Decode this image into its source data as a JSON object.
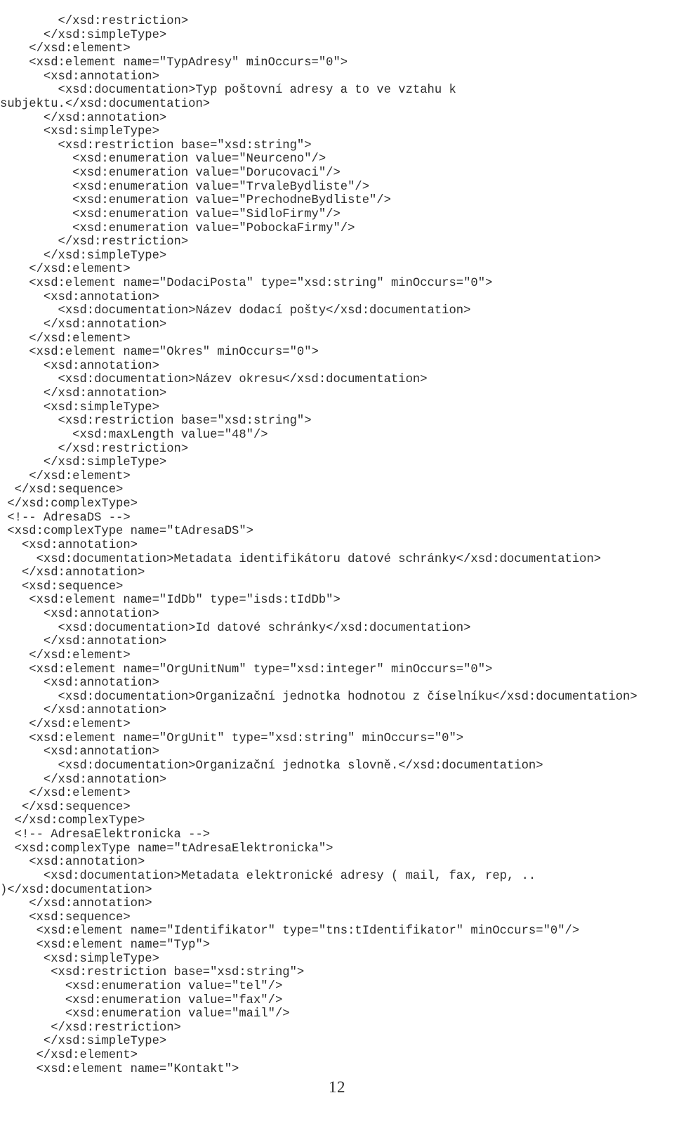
{
  "document": {
    "kind": "xsd-schema-listing",
    "page_number": "12",
    "language": "xml",
    "font_style": "monospace"
  },
  "code": {
    "lines": [
      "        </xsd:restriction>",
      "      </xsd:simpleType>",
      "    </xsd:element>",
      "    <xsd:element name=\"TypAdresy\" minOccurs=\"0\">",
      "      <xsd:annotation>",
      "        <xsd:documentation>Typ poštovní adresy a to ve vztahu k",
      "subjektu.</xsd:documentation>",
      "      </xsd:annotation>",
      "      <xsd:simpleType>",
      "        <xsd:restriction base=\"xsd:string\">",
      "          <xsd:enumeration value=\"Neurceno\"/>",
      "          <xsd:enumeration value=\"Dorucovaci\"/>",
      "          <xsd:enumeration value=\"TrvaleBydliste\"/>",
      "          <xsd:enumeration value=\"PrechodneBydliste\"/>",
      "          <xsd:enumeration value=\"SidloFirmy\"/>",
      "          <xsd:enumeration value=\"PobockaFirmy\"/>",
      "        </xsd:restriction>",
      "      </xsd:simpleType>",
      "    </xsd:element>",
      "    <xsd:element name=\"DodaciPosta\" type=\"xsd:string\" minOccurs=\"0\">",
      "      <xsd:annotation>",
      "        <xsd:documentation>Název dodací pošty</xsd:documentation>",
      "      </xsd:annotation>",
      "    </xsd:element>",
      "    <xsd:element name=\"Okres\" minOccurs=\"0\">",
      "      <xsd:annotation>",
      "        <xsd:documentation>Název okresu</xsd:documentation>",
      "      </xsd:annotation>",
      "      <xsd:simpleType>",
      "        <xsd:restriction base=\"xsd:string\">",
      "          <xsd:maxLength value=\"48\"/>",
      "        </xsd:restriction>",
      "      </xsd:simpleType>",
      "    </xsd:element>",
      "  </xsd:sequence>",
      " </xsd:complexType>",
      " <!-- AdresaDS -->",
      " <xsd:complexType name=\"tAdresaDS\">",
      "   <xsd:annotation>",
      "     <xsd:documentation>Metadata identifikátoru datové schránky</xsd:documentation>",
      "   </xsd:annotation>",
      "   <xsd:sequence>",
      "    <xsd:element name=\"IdDb\" type=\"isds:tIdDb\">",
      "      <xsd:annotation>",
      "        <xsd:documentation>Id datové schránky</xsd:documentation>",
      "      </xsd:annotation>",
      "    </xsd:element>",
      "    <xsd:element name=\"OrgUnitNum\" type=\"xsd:integer\" minOccurs=\"0\">",
      "      <xsd:annotation>",
      "        <xsd:documentation>Organizační jednotka hodnotou z číselníku</xsd:documentation>",
      "      </xsd:annotation>",
      "    </xsd:element>",
      "    <xsd:element name=\"OrgUnit\" type=\"xsd:string\" minOccurs=\"0\">",
      "      <xsd:annotation>",
      "        <xsd:documentation>Organizační jednotka slovně.</xsd:documentation>",
      "      </xsd:annotation>",
      "    </xsd:element>",
      "   </xsd:sequence>",
      "  </xsd:complexType>",
      "  <!-- AdresaElektronicka -->",
      "  <xsd:complexType name=\"tAdresaElektronicka\">",
      "    <xsd:annotation>",
      "      <xsd:documentation>Metadata elektronické adresy ( mail, fax, rep, ..",
      ")</xsd:documentation>",
      "    </xsd:annotation>",
      "    <xsd:sequence>",
      "     <xsd:element name=\"Identifikator\" type=\"tns:tIdentifikator\" minOccurs=\"0\"/>",
      "     <xsd:element name=\"Typ\">",
      "      <xsd:simpleType>",
      "       <xsd:restriction base=\"xsd:string\">",
      "         <xsd:enumeration value=\"tel\"/>",
      "         <xsd:enumeration value=\"fax\"/>",
      "         <xsd:enumeration value=\"mail\"/>",
      "       </xsd:restriction>",
      "      </xsd:simpleType>",
      "     </xsd:element>",
      "     <xsd:element name=\"Kontakt\">"
    ]
  },
  "footer": {
    "page_number": "12"
  },
  "colors": {
    "page_background": "#ffffff",
    "text": "#2b2b2b"
  }
}
